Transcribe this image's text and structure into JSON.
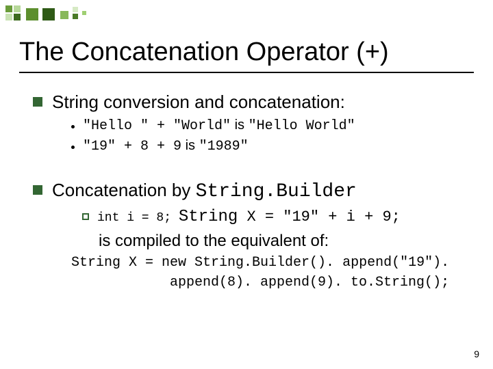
{
  "title": "The Concatenation Operator (+)",
  "section1": {
    "heading": "String conversion and concatenation:",
    "items": [
      {
        "code": "\"Hello \" + \"World\"",
        "mid": " is ",
        "result": "\"Hello World\""
      },
      {
        "code": "\"19\" + 8 + 9",
        "mid": " is ",
        "result": "\"1989\""
      }
    ]
  },
  "section2": {
    "heading_pre": "Concatenation by ",
    "heading_code": "String.Builder",
    "sub_pre": "int i = 8; ",
    "sub_code": "String",
    "sub_post": " X = \"19\" + i + 9;",
    "followup": "is compiled to the equivalent of:",
    "code1": "String X = new String.Builder(). append(\"19\").",
    "code2": "append(8). append(9). to.String();"
  },
  "page": "9"
}
